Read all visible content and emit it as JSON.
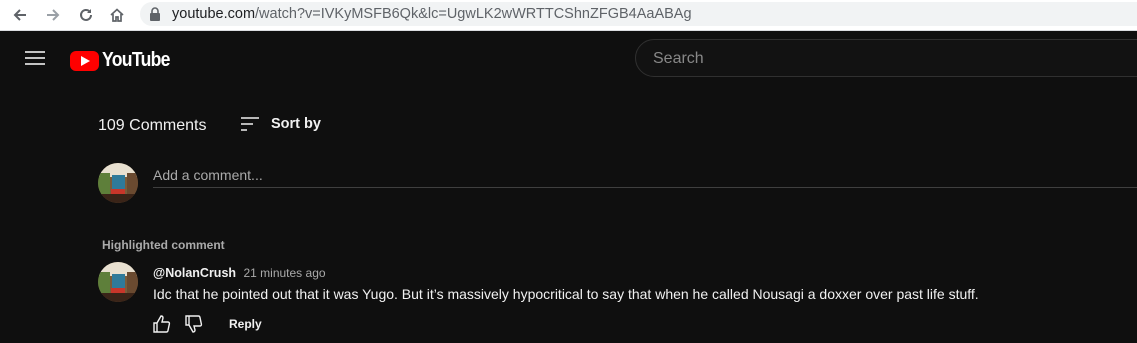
{
  "browser": {
    "url_host": "youtube.com",
    "url_path": "/watch?v=IVKyMSFB6Qk&lc=UgwLK2wWRTTCShnZFGB4AaABAg"
  },
  "masthead": {
    "logo_text": "YouTube",
    "search_placeholder": "Search"
  },
  "comments": {
    "count_label": "109 Comments",
    "sort_label": "Sort by",
    "add_placeholder": "Add a comment...",
    "highlighted_label": "Highlighted comment",
    "items": [
      {
        "author": "@NolanCrush",
        "time": "21 minutes ago",
        "text": "Idc that he pointed out that it was Yugo. But it’s massively hypocritical to say that when he called Nousagi a doxxer over past life stuff.",
        "reply_label": "Reply"
      }
    ]
  },
  "colors": {
    "background": "#0f0f0f",
    "brand_red": "#ff0000",
    "text_primary": "#f1f1f1",
    "text_secondary": "#aaaaaa"
  }
}
